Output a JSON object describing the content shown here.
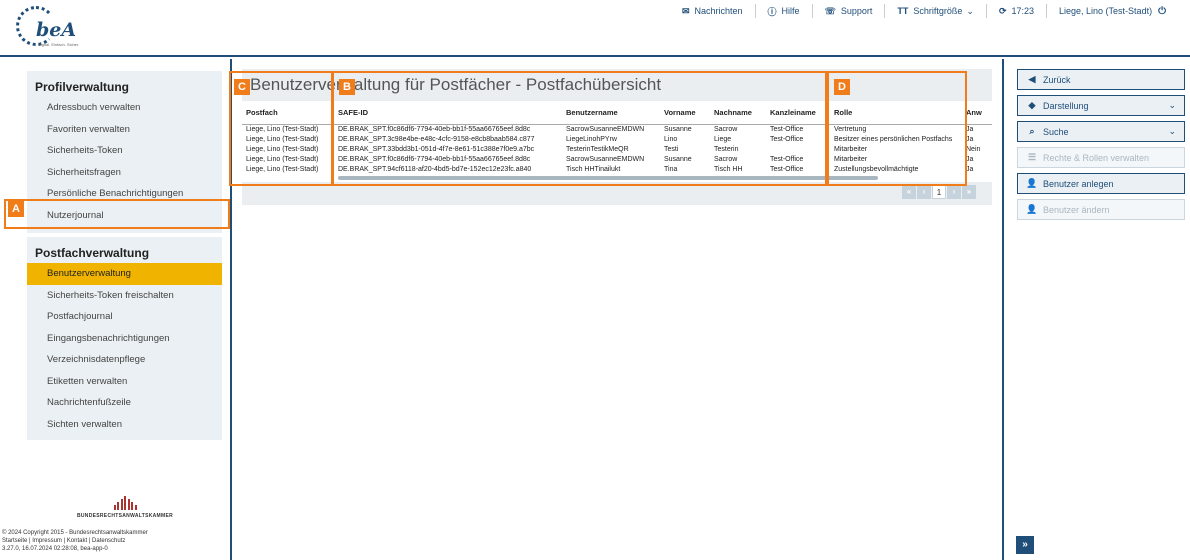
{
  "header": {
    "logo_text": "beA",
    "logo_tagline": "Digital. Einfach. Sicher.",
    "nav": [
      {
        "icon": "envelope-icon",
        "label": "Nachrichten"
      },
      {
        "icon": "help-icon",
        "label": "Hilfe"
      },
      {
        "icon": "support-icon",
        "label": "Support"
      },
      {
        "icon": "font-size-icon",
        "label": "Schriftgröße"
      },
      {
        "icon": "refresh-icon",
        "label": "17:23"
      },
      {
        "icon": "power-icon",
        "label": "Liege, Lino (Test-Stadt)"
      }
    ]
  },
  "sidebar": {
    "profil_title": "Profilverwaltung",
    "profil_items": [
      "Adressbuch verwalten",
      "Favoriten verwalten",
      "Sicherheits-Token",
      "Sicherheitsfragen",
      "Persönliche Benachrichtigungen",
      "Nutzerjournal"
    ],
    "postfach_title": "Postfachverwaltung",
    "postfach_items": [
      "Benutzerverwaltung",
      "Sicherheits-Token freischalten",
      "Postfachjournal",
      "Eingangsbenachrichtigungen",
      "Verzeichnisdatenpflege",
      "Etiketten verwalten",
      "Nachrichtenfußzeile",
      "Sichten verwalten"
    ],
    "active_item": "Benutzerverwaltung",
    "brak_text": "BUNDESRECHTSANWALTSKAMMER",
    "copyright": "© 2024 Copyright 2015 - Bundesrechtsanwaltskammer",
    "links": "Startseite | Impressum | Kontakt | Datenschutz",
    "version": "3.27.0, 16.07.2024 02:28:08, bea-app-0"
  },
  "main": {
    "title": "Benutzerverwaltung für Postfächer - Postfachübersicht",
    "columns": [
      "Postfach",
      "SAFE-ID",
      "Benutzername",
      "Vorname",
      "Nachname",
      "Kanzleiname",
      "Rolle",
      "Anw"
    ],
    "rows": [
      [
        "Liege, Lino (Test-Stadt)",
        "DE.BRAK_SPT.f0c86df6-7794-40eb-bb1f-55aa66765eef.8d8c",
        "SacrowSusanneEMDWN",
        "Susanne",
        "Sacrow",
        "Test-Office",
        "Vertretung",
        "Ja"
      ],
      [
        "Liege, Lino (Test-Stadt)",
        "DE.BRAK_SPT.3c98e4be-e48c-4cfc-9158-e8cb8baab584.c877",
        "LiegeLinohPYrw",
        "Lino",
        "Liege",
        "Test-Office",
        "Besitzer eines persönlichen Postfachs",
        "Ja"
      ],
      [
        "Liege, Lino (Test-Stadt)",
        "DE.BRAK_SPT.33bdd3b1-051d-4f7e-8e61-51c388e7f0e9.a7bc",
        "TesterinTestikMeQR",
        "Testi",
        "Testerin",
        "",
        "Mitarbeiter",
        "Nein"
      ],
      [
        "Liege, Lino (Test-Stadt)",
        "DE.BRAK_SPT.f0c86df6-7794-40eb-bb1f-55aa66765eef.8d8c",
        "SacrowSusanneEMDWN",
        "Susanne",
        "Sacrow",
        "Test-Office",
        "Mitarbeiter",
        "Ja"
      ],
      [
        "Liege, Lino (Test-Stadt)",
        "DE.BRAK_SPT.94cf6118-af20-4bd5-bd7e-152ec12e23fc.a840",
        "Tisch HHTinailukt",
        "Tina",
        "Tisch HH",
        "Test-Office",
        "Zustellungsbevollmächtigte",
        "Ja"
      ]
    ],
    "pager": {
      "first": "«",
      "prev": "‹",
      "page": "1",
      "next": "›",
      "last": "»"
    },
    "badges": {
      "a": "A",
      "b": "B",
      "c": "C",
      "d": "D"
    }
  },
  "rightbar": {
    "buttons": [
      {
        "icon": "back-icon",
        "label": "Zurück",
        "disabled": false,
        "chevron": false
      },
      {
        "icon": "tag-icon",
        "label": "Darstellung",
        "disabled": false,
        "chevron": true
      },
      {
        "icon": "search-icon",
        "label": "Suche",
        "disabled": false,
        "chevron": true
      },
      {
        "icon": "list-icon",
        "label": "Rechte & Rollen verwalten",
        "disabled": true,
        "chevron": false
      },
      {
        "icon": "add-user-icon",
        "label": "Benutzer anlegen",
        "disabled": false,
        "chevron": false
      },
      {
        "icon": "user-icon",
        "label": "Benutzer ändern",
        "disabled": true,
        "chevron": false
      }
    ],
    "expand": "»"
  }
}
